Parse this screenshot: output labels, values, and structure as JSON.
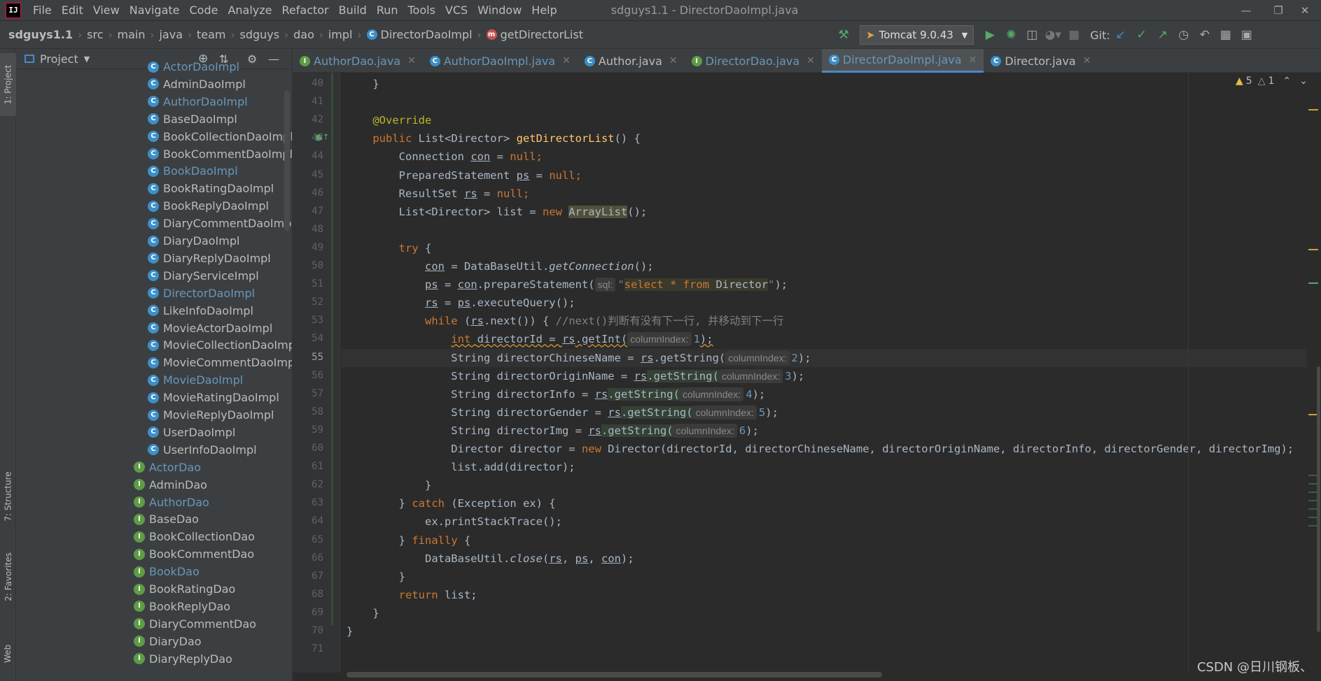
{
  "app": {
    "logo": "IJ",
    "menu": [
      "File",
      "Edit",
      "View",
      "Navigate",
      "Code",
      "Analyze",
      "Refactor",
      "Build",
      "Run",
      "Tools",
      "VCS",
      "Window",
      "Help"
    ],
    "window_title": "sdguys1.1 - DirectorDaoImpl.java"
  },
  "breadcrumb": [
    "sdguys1.1",
    "src",
    "main",
    "java",
    "team",
    "sdguys",
    "dao",
    "impl",
    "DirectorDaoImpl",
    "getDirectorList"
  ],
  "toolbar": {
    "run_config": "Tomcat 9.0.43",
    "git_label": "Git:"
  },
  "left_strip": {
    "project": "1: Project",
    "structure": "7: Structure",
    "favorites": "2: Favorites",
    "web": "Web"
  },
  "project_panel": {
    "title": "Project",
    "impl_items": [
      {
        "name": "ActorDaoImpl",
        "mod": true
      },
      {
        "name": "AdminDaoImpl",
        "mod": false
      },
      {
        "name": "AuthorDaoImpl",
        "mod": true
      },
      {
        "name": "BaseDaoImpl",
        "mod": false
      },
      {
        "name": "BookCollectionDaoImpl",
        "mod": false
      },
      {
        "name": "BookCommentDaoImpl",
        "mod": false
      },
      {
        "name": "BookDaoImpl",
        "mod": true
      },
      {
        "name": "BookRatingDaoImpl",
        "mod": false
      },
      {
        "name": "BookReplyDaoImpl",
        "mod": false
      },
      {
        "name": "DiaryCommentDaoImpl",
        "mod": false
      },
      {
        "name": "DiaryDaoImpl",
        "mod": false
      },
      {
        "name": "DiaryReplyDaoImpl",
        "mod": false
      },
      {
        "name": "DiaryServiceImpl",
        "mod": false
      },
      {
        "name": "DirectorDaoImpl",
        "mod": true
      },
      {
        "name": "LikeInfoDaoImpl",
        "mod": false
      },
      {
        "name": "MovieActorDaoImpl",
        "mod": false
      },
      {
        "name": "MovieCollectionDaoImpl",
        "mod": false
      },
      {
        "name": "MovieCommentDaoImpl",
        "mod": false
      },
      {
        "name": "MovieDaoImpl",
        "mod": true
      },
      {
        "name": "MovieRatingDaoImpl",
        "mod": false
      },
      {
        "name": "MovieReplyDaoImpl",
        "mod": false
      },
      {
        "name": "UserDaoImpl",
        "mod": false
      },
      {
        "name": "UserInfoDaoImpl",
        "mod": false
      }
    ],
    "dao_items": [
      {
        "name": "ActorDao",
        "mod": true
      },
      {
        "name": "AdminDao",
        "mod": false
      },
      {
        "name": "AuthorDao",
        "mod": true
      },
      {
        "name": "BaseDao",
        "mod": false
      },
      {
        "name": "BookCollectionDao",
        "mod": false
      },
      {
        "name": "BookCommentDao",
        "mod": false
      },
      {
        "name": "BookDao",
        "mod": true
      },
      {
        "name": "BookRatingDao",
        "mod": false
      },
      {
        "name": "BookReplyDao",
        "mod": false
      },
      {
        "name": "DiaryCommentDao",
        "mod": false
      },
      {
        "name": "DiaryDao",
        "mod": false
      },
      {
        "name": "DiaryReplyDao",
        "mod": false
      }
    ]
  },
  "tabs": [
    {
      "name": "AuthorDao.java",
      "kind": "I",
      "vcs": true,
      "active": false
    },
    {
      "name": "AuthorDaoImpl.java",
      "kind": "C",
      "vcs": true,
      "active": false
    },
    {
      "name": "Author.java",
      "kind": "C",
      "vcs": false,
      "active": false
    },
    {
      "name": "DirectorDao.java",
      "kind": "I",
      "vcs": true,
      "active": false
    },
    {
      "name": "DirectorDaoImpl.java",
      "kind": "C",
      "vcs": true,
      "active": true
    },
    {
      "name": "Director.java",
      "kind": "C",
      "vcs": false,
      "active": false
    }
  ],
  "inspections": {
    "warnings": "5",
    "weak_warnings": "1"
  },
  "editor": {
    "first_line": 40,
    "current_line": 55,
    "lines": [
      [
        [
          "    }",
          "p"
        ]
      ],
      [],
      [
        [
          "    ",
          "p"
        ],
        [
          "@Override",
          "ann"
        ]
      ],
      [
        [
          "    ",
          "p"
        ],
        [
          "public ",
          "kw"
        ],
        [
          "List<Director> ",
          "p"
        ],
        [
          "getDirectorList",
          "fn"
        ],
        [
          "() {",
          "p"
        ]
      ],
      [
        [
          "        Connection ",
          "p"
        ],
        [
          "con",
          "ul"
        ],
        [
          " = ",
          "p"
        ],
        [
          "null",
          "kw"
        ],
        [
          ";",
          "kw"
        ]
      ],
      [
        [
          "        PreparedStatement ",
          "p"
        ],
        [
          "ps",
          "ul"
        ],
        [
          " = ",
          "p"
        ],
        [
          "null",
          "kw"
        ],
        [
          ";",
          "kw"
        ]
      ],
      [
        [
          "        ResultSet ",
          "p"
        ],
        [
          "rs",
          "ul"
        ],
        [
          " = ",
          "p"
        ],
        [
          "null",
          "kw"
        ],
        [
          ";",
          "kw"
        ]
      ],
      [
        [
          "        List<Director> list = ",
          "p"
        ],
        [
          "new ",
          "kw"
        ],
        [
          "ArrayList",
          "warnhl"
        ],
        [
          "();",
          "p"
        ]
      ],
      [],
      [
        [
          "        ",
          "p"
        ],
        [
          "try ",
          "kw"
        ],
        [
          "{",
          "p"
        ]
      ],
      [
        [
          "            ",
          "p"
        ],
        [
          "con",
          "ul"
        ],
        [
          " = DataBaseUtil.",
          "p"
        ],
        [
          "getConnection",
          "it"
        ],
        [
          "();",
          "p"
        ]
      ],
      [
        [
          "            ",
          "p"
        ],
        [
          "ps",
          "ul"
        ],
        [
          " = ",
          "p"
        ],
        [
          "con",
          "ul"
        ],
        [
          ".prepareStatement(",
          "p"
        ],
        [
          "sql:",
          "hint"
        ],
        [
          "\"",
          "str"
        ],
        [
          "select * from ",
          "sqlkw"
        ],
        [
          "Director",
          "sql"
        ],
        [
          "\"",
          "str"
        ],
        [
          ");",
          "p"
        ]
      ],
      [
        [
          "            ",
          "p"
        ],
        [
          "rs",
          "ul"
        ],
        [
          " = ",
          "p"
        ],
        [
          "ps",
          "ul"
        ],
        [
          ".executeQuery();",
          "p"
        ]
      ],
      [
        [
          "            ",
          "p"
        ],
        [
          "while ",
          "kw"
        ],
        [
          "(",
          "p"
        ],
        [
          "rs",
          "ul"
        ],
        [
          ".next()) { ",
          "p"
        ],
        [
          "//next()判断有没有下一行, 并移动到下一行",
          "com"
        ]
      ],
      [
        [
          "                ",
          "p"
        ],
        [
          "int ",
          "kwul"
        ],
        [
          "directorId = ",
          "pwul"
        ],
        [
          "rs",
          "ulw"
        ],
        [
          ".getInt(",
          "pwul"
        ],
        [
          "columnIndex:",
          "hint"
        ],
        [
          "1",
          "num"
        ],
        [
          ");",
          "pwul"
        ]
      ],
      [
        [
          "                String directorChineseName = ",
          "p"
        ],
        [
          "rs",
          "ul"
        ],
        [
          ".getString(",
          "p"
        ],
        [
          "columnIndex:",
          "hint"
        ],
        [
          "2",
          "num"
        ],
        [
          ");",
          "p"
        ]
      ],
      [
        [
          "                String directorOriginName = ",
          "p"
        ],
        [
          "rs",
          "ul"
        ],
        [
          ".getString(",
          "hl"
        ],
        [
          "columnIndex:",
          "hint"
        ],
        [
          "3",
          "num"
        ],
        [
          ");",
          "p"
        ]
      ],
      [
        [
          "                String directorInfo = ",
          "p"
        ],
        [
          "rs",
          "ul"
        ],
        [
          ".getString(",
          "hl"
        ],
        [
          "columnIndex:",
          "hint"
        ],
        [
          "4",
          "num"
        ],
        [
          ");",
          "p"
        ]
      ],
      [
        [
          "                String directorGender = ",
          "p"
        ],
        [
          "rs",
          "ul"
        ],
        [
          ".getString(",
          "hl"
        ],
        [
          "columnIndex:",
          "hint"
        ],
        [
          "5",
          "num"
        ],
        [
          ");",
          "p"
        ]
      ],
      [
        [
          "                String directorImg = ",
          "p"
        ],
        [
          "rs",
          "ul"
        ],
        [
          ".getString(",
          "hl"
        ],
        [
          "columnIndex:",
          "hint"
        ],
        [
          "6",
          "num"
        ],
        [
          ");",
          "p"
        ]
      ],
      [
        [
          "                Director director = ",
          "p"
        ],
        [
          "new ",
          "kw"
        ],
        [
          "Director(directorId, directorChineseName, directorOriginName, directorInfo, directorGender, directorImg);",
          "p"
        ]
      ],
      [
        [
          "                list.add(director);",
          "p"
        ]
      ],
      [
        [
          "            }",
          "p"
        ]
      ],
      [
        [
          "        } ",
          "p"
        ],
        [
          "catch ",
          "kw"
        ],
        [
          "(Exception ex) {",
          "p"
        ]
      ],
      [
        [
          "            ex.printStackTrace();",
          "p"
        ]
      ],
      [
        [
          "        } ",
          "p"
        ],
        [
          "finally ",
          "kw"
        ],
        [
          "{",
          "p"
        ]
      ],
      [
        [
          "            DataBaseUtil.",
          "p"
        ],
        [
          "close",
          "it"
        ],
        [
          "(",
          "p"
        ],
        [
          "rs",
          "ul"
        ],
        [
          ", ",
          "p"
        ],
        [
          "ps",
          "ul"
        ],
        [
          ", ",
          "p"
        ],
        [
          "con",
          "ul"
        ],
        [
          ");",
          "p"
        ]
      ],
      [
        [
          "        }",
          "p"
        ]
      ],
      [
        [
          "        ",
          "p"
        ],
        [
          "return ",
          "kw"
        ],
        [
          "list;",
          "p"
        ]
      ],
      [
        [
          "    }",
          "p"
        ]
      ],
      [
        [
          "}",
          "p"
        ]
      ],
      []
    ]
  },
  "watermark": "CSDN @日川钢板、"
}
